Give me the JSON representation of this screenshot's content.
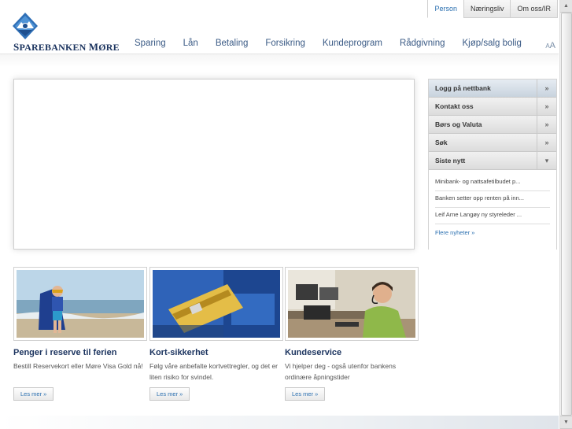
{
  "util_tabs": [
    {
      "label": "Person",
      "active": true
    },
    {
      "label": "Næringsliv",
      "active": false
    },
    {
      "label": "Om oss/IR",
      "active": false
    }
  ],
  "logo": {
    "text_a": "S",
    "text_b": "PAREBANKEN ",
    "text_c": "M",
    "text_d": "ØRE"
  },
  "nav": [
    "Sparing",
    "Lån",
    "Betaling",
    "Forsikring",
    "Kundeprogram",
    "Rådgivning",
    "Kjøp/salg bolig"
  ],
  "text_size": {
    "small": "A",
    "large": "A"
  },
  "sidebar": {
    "items": [
      {
        "label": "Logg på nettbank",
        "arrow": "»"
      },
      {
        "label": "Kontakt oss",
        "arrow": "»"
      },
      {
        "label": "Børs og Valuta",
        "arrow": "»"
      },
      {
        "label": "Søk",
        "arrow": "»"
      },
      {
        "label": "Siste nytt",
        "arrow": "▾"
      }
    ],
    "news": [
      "Minibank- og nattsafetilbudet p...",
      "Banken setter opp renten på inn...",
      "Leif Arne Langøy ny styreleder ..."
    ],
    "more": "Flere nyheter »"
  },
  "cards": [
    {
      "title": "Penger i reserve til ferien",
      "text": "Bestill Reservekort eller Møre Visa Gold nå!",
      "button": "Les mer »"
    },
    {
      "title": "Kort-sikkerhet",
      "text": "Følg våre anbefalte kortvettregler, og det er liten risiko for svindel.",
      "button": "Les mer »"
    },
    {
      "title": "Kundeservice",
      "text": "Vi hjelper deg - også utenfor bankens ordinære åpningstider",
      "button": "Les mer »"
    }
  ],
  "colors": {
    "brand": "#1d3560",
    "link": "#2a6fb0",
    "nav": "#3a5a85"
  }
}
